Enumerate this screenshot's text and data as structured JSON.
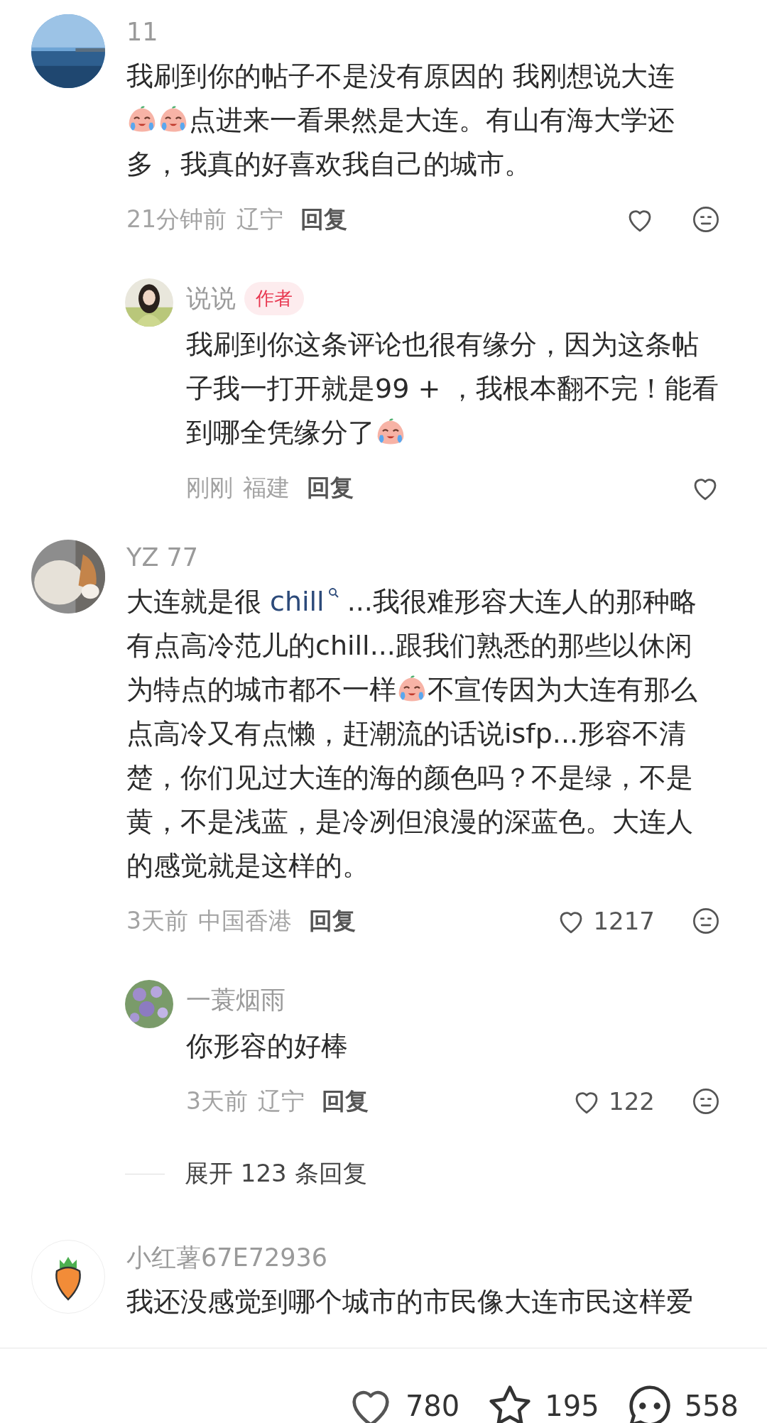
{
  "comments": [
    {
      "avatar": {
        "kind": "sea"
      },
      "name": "11",
      "lines": [
        [
          {
            "kind": "text",
            "text": "我刷到你的帖子不是没有原因的 我刚想说大连"
          }
        ],
        [
          {
            "kind": "emoji"
          },
          {
            "kind": "emoji"
          },
          {
            "kind": "text",
            "text": "点进来一看果然是大连。有山有海大学还"
          }
        ],
        [
          {
            "kind": "text",
            "text": "多，我真的好喜欢我自己的城市。"
          }
        ]
      ],
      "time": "21分钟前",
      "location": "辽宁",
      "reply_label": "回复",
      "liked": false,
      "dislike_button": true,
      "replies": [
        {
          "avatar": {
            "kind": "person"
          },
          "name": "说说",
          "badge": "作者",
          "lines": [
            [
              {
                "kind": "text",
                "text": "我刷到你这条评论也很有缘分，因为这条帖"
              }
            ],
            [
              {
                "kind": "text",
                "text": "子我一打开就是99 + ，我根本翻不完！能看"
              }
            ],
            [
              {
                "kind": "text",
                "text": "到哪全凭缘分了"
              },
              {
                "kind": "emoji"
              }
            ]
          ],
          "time": "刚刚",
          "location": "福建",
          "reply_label": "回复",
          "liked": false,
          "dislike_button": false
        }
      ]
    },
    {
      "avatar": {
        "kind": "pet"
      },
      "name": "YZ 77",
      "lines": [
        [
          {
            "kind": "text",
            "text": "大连就是很"
          },
          {
            "kind": "link",
            "text": "chill"
          },
          {
            "kind": "text",
            "text": "...我很难形容大连人的那种略"
          }
        ],
        [
          {
            "kind": "text",
            "text": "有点高冷范儿的chill...跟我们熟悉的那些以休闲"
          }
        ],
        [
          {
            "kind": "text",
            "text": "为特点的城市都不一样"
          },
          {
            "kind": "emoji"
          },
          {
            "kind": "text",
            "text": "不宣传因为大连有那么"
          }
        ],
        [
          {
            "kind": "text",
            "text": "点高冷又有点懒，赶潮流的话说isfp...形容不清"
          }
        ],
        [
          {
            "kind": "text",
            "text": "楚，你们见过大连的海的颜色吗？不是绿，不是"
          }
        ],
        [
          {
            "kind": "text",
            "text": "黄，不是浅蓝，是冷冽但浪漫的深蓝色。大连人"
          }
        ],
        [
          {
            "kind": "text",
            "text": "的感觉就是这样的。"
          }
        ]
      ],
      "time": "3天前",
      "location": "中国香港",
      "reply_label": "回复",
      "liked": false,
      "likes": "1217",
      "dislike_button": true,
      "replies": [
        {
          "avatar": {
            "kind": "flowers"
          },
          "name": "一蓑烟雨",
          "lines": [
            [
              {
                "kind": "text",
                "text": "你形容的好棒"
              }
            ]
          ],
          "time": "3天前",
          "location": "辽宁",
          "reply_label": "回复",
          "liked": false,
          "likes": "122",
          "dislike_button": true
        }
      ],
      "expand": "展开 123 条回复"
    },
    {
      "avatar": {
        "kind": "carrot"
      },
      "name": "小红薯67E72936",
      "lines": [
        [
          {
            "kind": "text",
            "text": "我还没感觉到哪个城市的市民像大连市民这样爱"
          }
        ]
      ]
    }
  ],
  "bottom_bar": {
    "likes": "780",
    "favorites": "195",
    "comments": "558"
  }
}
